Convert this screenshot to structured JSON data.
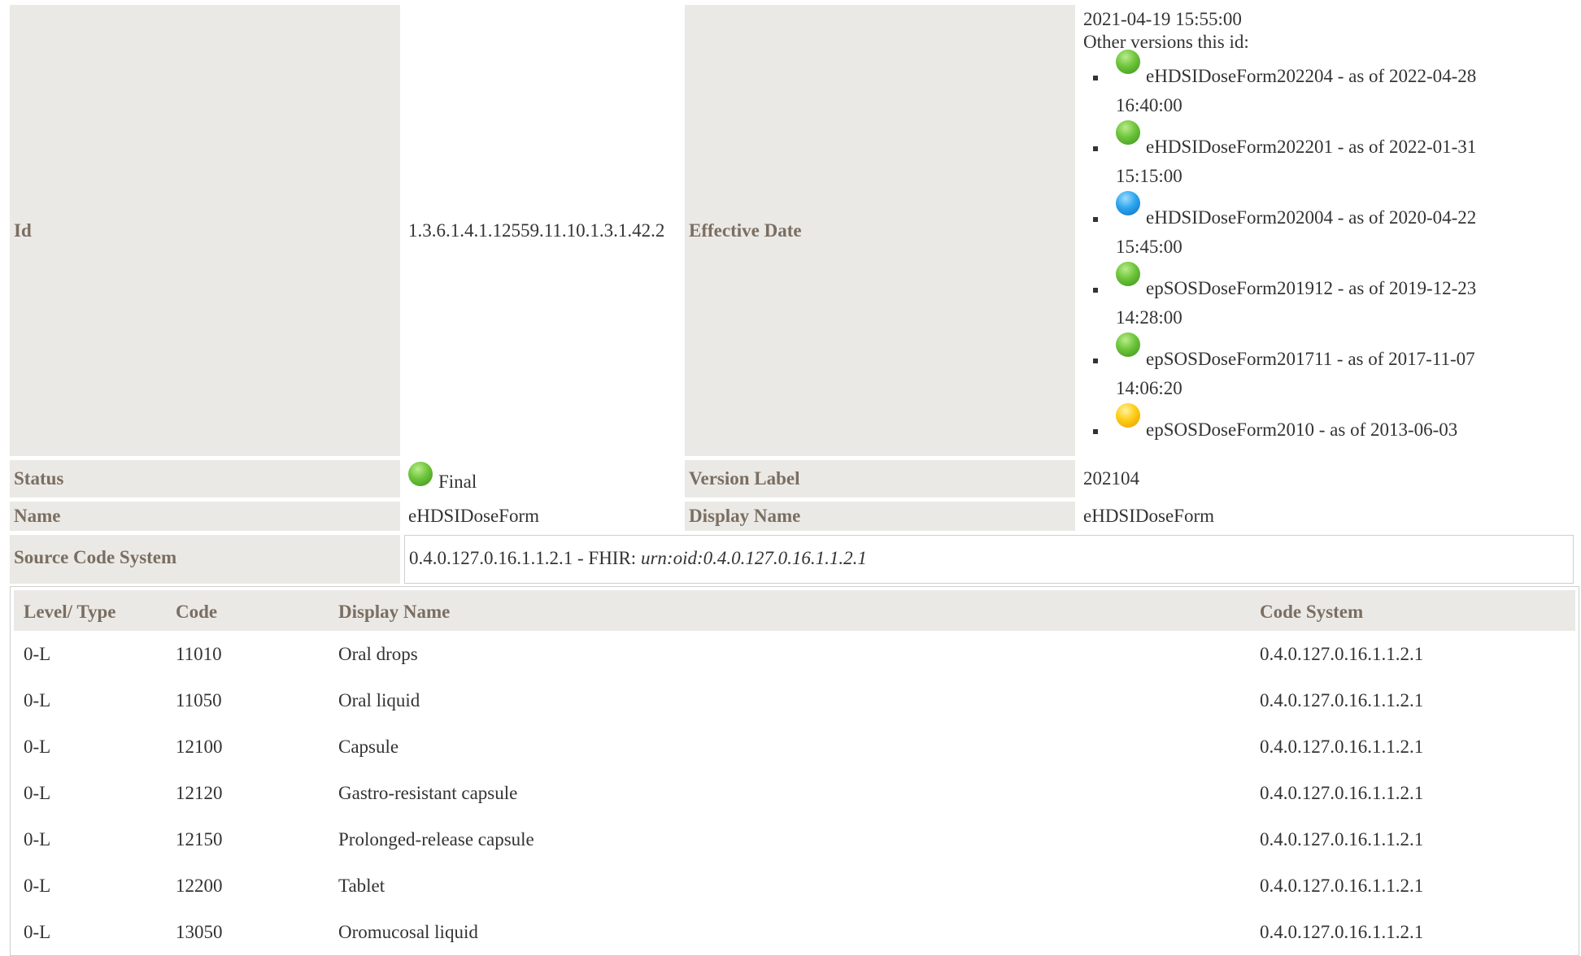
{
  "meta": {
    "id_label": "Id",
    "id_value": "1.3.6.1.4.1.12559.11.10.1.3.1.42.2",
    "effective_label": "Effective Date",
    "effective_value": "2021-04-19 15:55:00",
    "other_versions_label": "Other versions this id:",
    "versions": [
      {
        "text": "eHDSIDoseForm202204 - as of 2022-04-28 16:40:00",
        "status": "green"
      },
      {
        "text": "eHDSIDoseForm202201 - as of 2022-01-31 15:15:00",
        "status": "green"
      },
      {
        "text": "eHDSIDoseForm202004 - as of 2020-04-22 15:45:00",
        "status": "blue"
      },
      {
        "text": "epSOSDoseForm201912 - as of 2019-12-23 14:28:00",
        "status": "green"
      },
      {
        "text": "epSOSDoseForm201711 - as of 2017-11-07 14:06:20",
        "status": "green"
      },
      {
        "text": "epSOSDoseForm2010 - as of 2013-06-03",
        "status": "yellow"
      }
    ],
    "status_label": "Status",
    "status_value": "Final",
    "version_label_label": "Version Label",
    "version_label_value": "202104",
    "name_label": "Name",
    "name_value": "eHDSIDoseForm",
    "display_name_label": "Display Name",
    "display_name_value": "eHDSIDoseForm",
    "source_label": "Source Code System",
    "source_value": "0.4.0.127.0.16.1.1.2.1 - FHIR: ",
    "source_urn": "urn:oid:0.4.0.127.0.16.1.1.2.1"
  },
  "concepts": {
    "headers": [
      "Level/ Type",
      "Code",
      "Display Name",
      "Code System"
    ],
    "rows": [
      [
        "0-L",
        "11010",
        "Oral drops",
        "0.4.0.127.0.16.1.1.2.1"
      ],
      [
        "0-L",
        "11050",
        "Oral liquid",
        "0.4.0.127.0.16.1.1.2.1"
      ],
      [
        "0-L",
        "12100",
        "Capsule",
        "0.4.0.127.0.16.1.1.2.1"
      ],
      [
        "0-L",
        "12120",
        "Gastro-resistant capsule",
        "0.4.0.127.0.16.1.1.2.1"
      ],
      [
        "0-L",
        "12150",
        "Prolonged-release capsule",
        "0.4.0.127.0.16.1.1.2.1"
      ],
      [
        "0-L",
        "12200",
        "Tablet",
        "0.4.0.127.0.16.1.1.2.1"
      ],
      [
        "0-L",
        "13050",
        "Oromucosal liquid",
        "0.4.0.127.0.16.1.1.2.1"
      ]
    ]
  },
  "colors": {
    "label_bg": "#ebe9e5",
    "label_text": "#7a6e62",
    "status_final": "#6cc43a",
    "status_blue": "#2aa5ef",
    "status_yellow": "#ffcc14"
  }
}
